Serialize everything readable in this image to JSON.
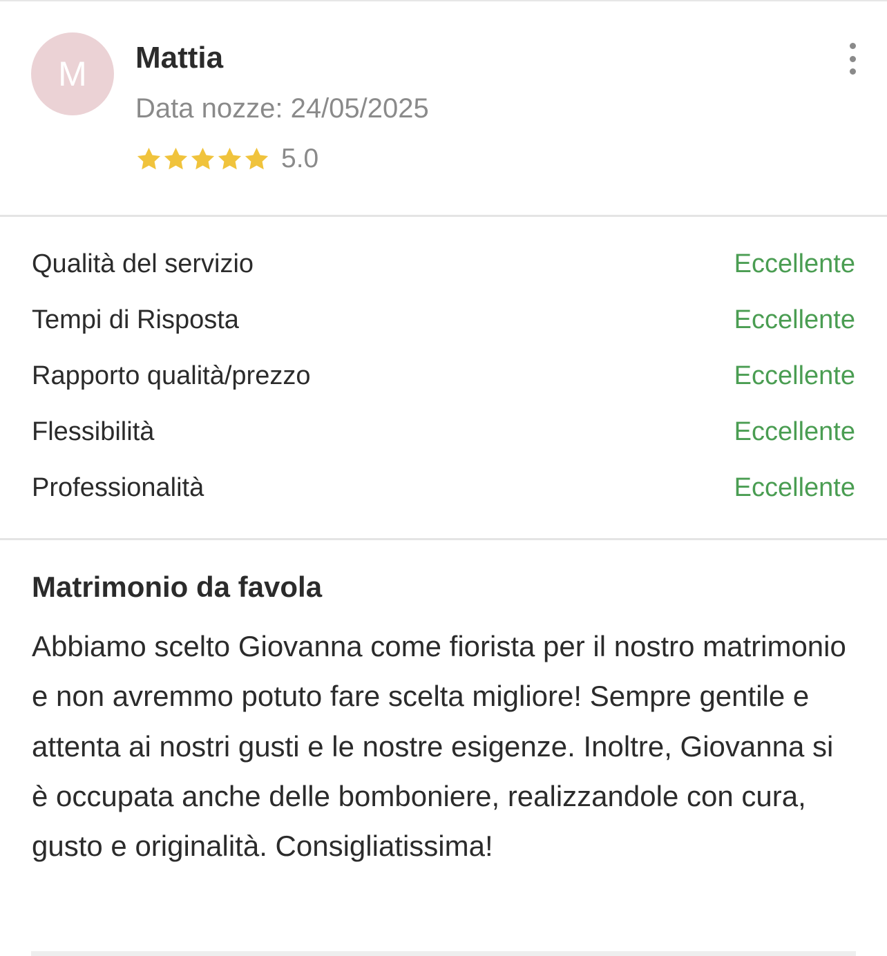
{
  "review": {
    "avatar_initial": "M",
    "reviewer_name": "Mattia",
    "wedding_date": "Data nozze: 24/05/2025",
    "rating": 5,
    "rating_text": "5.0",
    "star_color": "#f0c33c",
    "more_icon": "vertical-dots-icon"
  },
  "ratings": [
    {
      "label": "Qualità del servizio",
      "score": "Eccellente"
    },
    {
      "label": "Tempi di Risposta",
      "score": "Eccellente"
    },
    {
      "label": "Rapporto qualità/prezzo",
      "score": "Eccellente"
    },
    {
      "label": "Flessibilità",
      "score": "Eccellente"
    },
    {
      "label": "Professionalità",
      "score": "Eccellente"
    }
  ],
  "body": {
    "title": "Matrimonio da favola",
    "text": "Abbiamo scelto Giovanna come fiorista per il nostro matrimonio e non avremmo potuto fare scelta migliore! Sempre gentile e attenta ai nostri gusti e le nostre esigenze. Inoltre, Giovanna si è occupata anche delle bomboniere, realizzandole con cura, gusto e originalità. Consigliatissima!"
  },
  "colors": {
    "accent_green": "#4a9d52",
    "avatar_bg": "#ebd2d5",
    "muted_text": "#8a8a8a"
  }
}
